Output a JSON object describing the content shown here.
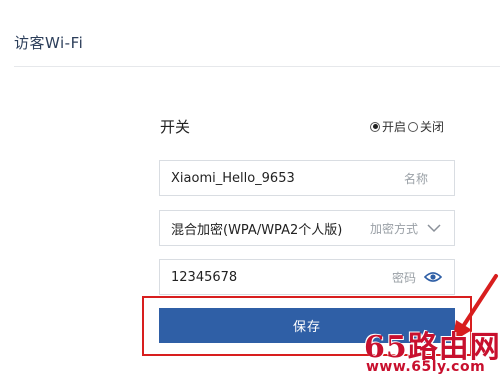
{
  "page": {
    "title": "访客Wi-Fi"
  },
  "switch": {
    "label": "开关",
    "options": [
      {
        "label": "开启",
        "checked": true
      },
      {
        "label": "关闭",
        "checked": false
      }
    ]
  },
  "form": {
    "ssid": {
      "value": "Xiaomi_Hello_9653",
      "hint": "名称"
    },
    "encryption": {
      "value": "混合加密(WPA/WPA2个人版)",
      "hint": "加密方式"
    },
    "password": {
      "value": "12345678",
      "hint": "密码"
    }
  },
  "actions": {
    "save_label": "保存"
  },
  "annotation": {
    "highlight_color": "#d81e1e"
  },
  "watermark": {
    "main": "65路由网",
    "sub": "www.65ly.com"
  },
  "colors": {
    "accent": "#2f5fa6",
    "eye_icon": "#2f5fa6"
  }
}
